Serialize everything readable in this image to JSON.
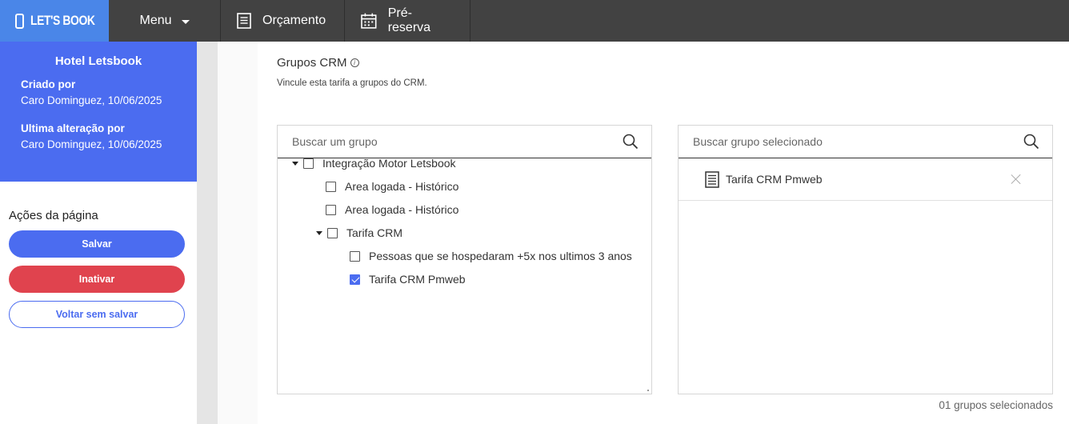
{
  "topbar": {
    "logo_text": "LET'S BOOK",
    "menu_label": "Menu",
    "nav": [
      {
        "label": "Orçamento",
        "icon": "document-icon"
      },
      {
        "label": "Pré-reserva",
        "icon": "calendar-icon"
      }
    ]
  },
  "sidebar": {
    "hotel_name": "Hotel Letsbook",
    "created_label": "Criado por",
    "created_value": "Caro Dominguez, 10/06/2025",
    "updated_label": "Ultima alteração por",
    "updated_value": "Caro Dominguez, 10/06/2025",
    "actions_title": "Ações da página",
    "save_label": "Salvar",
    "inactivate_label": "Inativar",
    "back_label": "Voltar sem salvar"
  },
  "main": {
    "section_title": "Grupos CRM",
    "section_info_glyph": "i",
    "section_subtitle": "Vincule esta tarifa a grupos do CRM.",
    "left_panel": {
      "search_placeholder": "Buscar um grupo",
      "tree": [
        {
          "label": "Integração Motor Letsbook",
          "level": 0,
          "expanded": true,
          "checked": false
        },
        {
          "label": "Area logada - Histórico",
          "level": 1,
          "expanded": null,
          "checked": false
        },
        {
          "label": "Area logada - Histórico",
          "level": 1,
          "expanded": null,
          "checked": false
        },
        {
          "label": "Tarifa CRM",
          "level": 1,
          "expanded": true,
          "checked": false
        },
        {
          "label": "Pessoas que se hospedaram +5x nos ultimos 3 anos",
          "level": 2,
          "expanded": null,
          "checked": false
        },
        {
          "label": "Tarifa CRM Pmweb",
          "level": 2,
          "expanded": null,
          "checked": true
        }
      ]
    },
    "right_panel": {
      "search_placeholder": "Buscar grupo selecionado",
      "selected": [
        {
          "label": "Tarifa CRM Pmweb"
        }
      ]
    },
    "count_text": "01 grupos selecionados"
  },
  "colors": {
    "topbar_bg": "#424242",
    "logo_bg": "#4a86e8",
    "primary": "#4b6cf0",
    "danger": "#e0434e"
  }
}
